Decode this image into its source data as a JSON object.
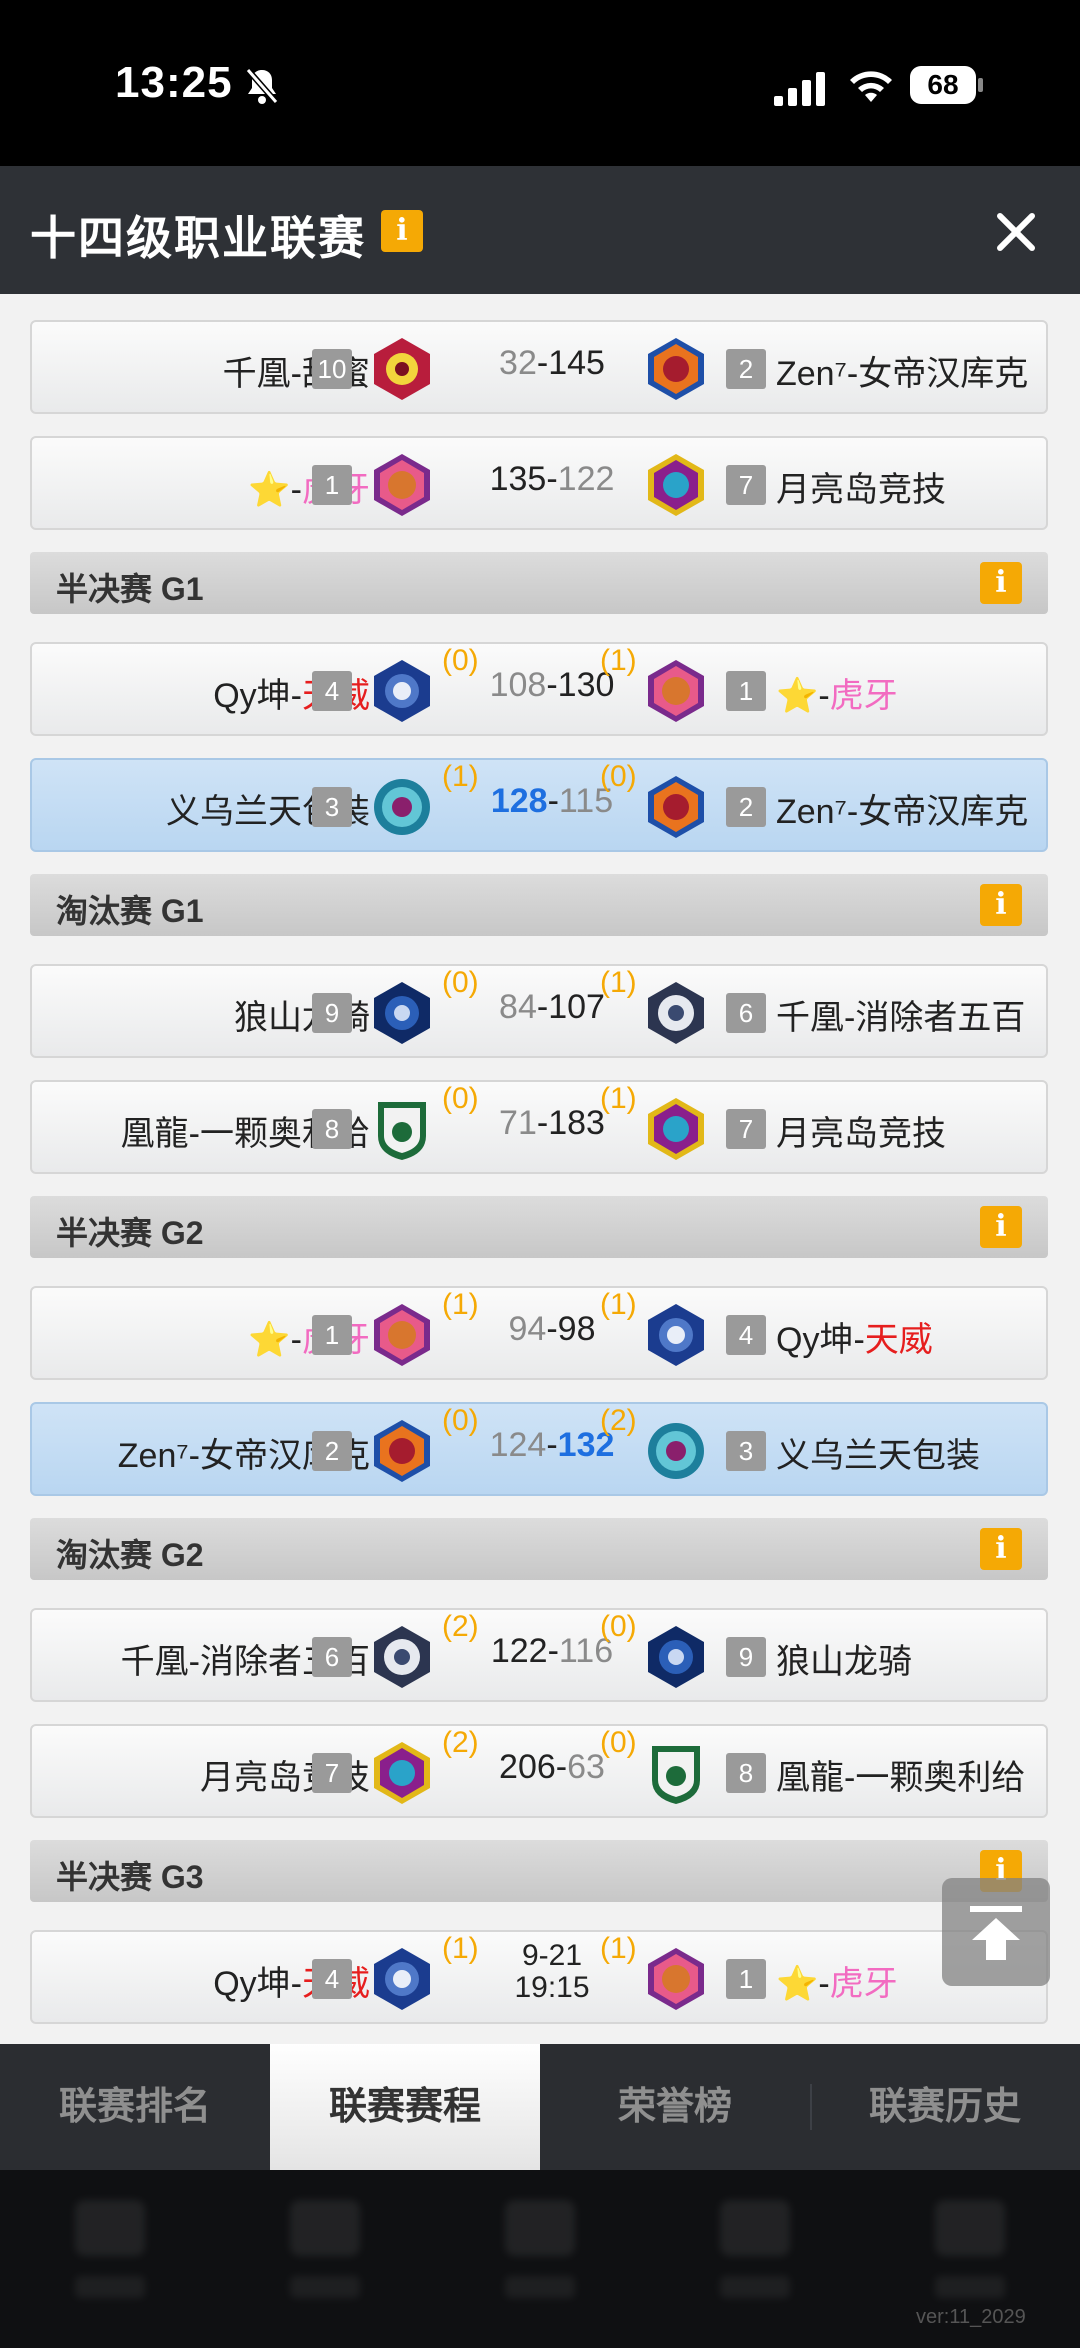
{
  "status_bar": {
    "time": "13:25",
    "battery": "68"
  },
  "header": {
    "title": "十四级职业联赛",
    "info_icon": "i"
  },
  "matches": [
    {
      "left": {
        "prefix": "千凰-",
        "name": "甜蜜",
        "seed": "10"
      },
      "score_left": "32",
      "sep": "-",
      "score_right": "145",
      "right": {
        "prefix": "Zen⁷-",
        "name": "女帝汉库克",
        "seed": "2"
      }
    },
    {
      "left": {
        "prefix": "⭐-",
        "name": "虎牙",
        "seed": "1"
      },
      "score_left": "135",
      "sep": "-",
      "score_right": "122",
      "right": {
        "prefix": "",
        "name": "月亮岛竞技",
        "seed": "7"
      }
    },
    {
      "left": {
        "prefix": "Qy坤-",
        "name": "天威",
        "seed": "4"
      },
      "wins_left": "(0)",
      "score_left": "108",
      "sep": "-",
      "score_right": "130",
      "wins_right": "(1)",
      "right": {
        "prefix": "⭐-",
        "name": "虎牙",
        "seed": "1"
      }
    },
    {
      "left": {
        "prefix": "",
        "name": "义乌兰天包装",
        "seed": "3"
      },
      "wins_left": "(1)",
      "score_left": "128",
      "sep": "-",
      "score_right": "115",
      "wins_right": "(0)",
      "right": {
        "prefix": "Zen⁷-",
        "name": "女帝汉库克",
        "seed": "2"
      }
    },
    {
      "left": {
        "prefix": "",
        "name": "狼山龙骑",
        "seed": "9"
      },
      "wins_left": "(0)",
      "score_left": "84",
      "sep": "-",
      "score_right": "107",
      "wins_right": "(1)",
      "right": {
        "prefix": "千凰-",
        "name": "消除者五百",
        "seed": "6"
      }
    },
    {
      "left": {
        "prefix": "凰龍-",
        "name": "一颗奥利给",
        "seed": "8"
      },
      "wins_left": "(0)",
      "score_left": "71",
      "sep": "-",
      "score_right": "183",
      "wins_right": "(1)",
      "right": {
        "prefix": "",
        "name": "月亮岛竞技",
        "seed": "7"
      }
    },
    {
      "left": {
        "prefix": "⭐-",
        "name": "虎牙",
        "seed": "1"
      },
      "wins_left": "(1)",
      "score_left": "94",
      "sep": "-",
      "score_right": "98",
      "wins_right": "(1)",
      "right": {
        "prefix": "Qy坤-",
        "name": "天威",
        "seed": "4"
      }
    },
    {
      "left": {
        "prefix": "Zen⁷-",
        "name": "女帝汉库克",
        "seed": "2"
      },
      "wins_left": "(0)",
      "score_left": "124",
      "sep": "-",
      "score_right": "132",
      "wins_right": "(2)",
      "right": {
        "prefix": "",
        "name": "义乌兰天包装",
        "seed": "3"
      }
    },
    {
      "left": {
        "prefix": "千凰-",
        "name": "消除者五百",
        "seed": "6"
      },
      "wins_left": "(2)",
      "score_left": "122",
      "sep": "-",
      "score_right": "116",
      "wins_right": "(0)",
      "right": {
        "prefix": "",
        "name": "狼山龙骑",
        "seed": "9"
      }
    },
    {
      "left": {
        "prefix": "",
        "name": "月亮岛竞技",
        "seed": "7"
      },
      "wins_left": "(2)",
      "score_left": "206",
      "sep": "-",
      "score_right": "63",
      "wins_right": "(0)",
      "right": {
        "prefix": "凰龍-",
        "name": "一颗奥利给",
        "seed": "8"
      }
    },
    {
      "left": {
        "prefix": "Qy坤-",
        "name": "天威",
        "seed": "4"
      },
      "wins_left": "(1)",
      "date": "9-21",
      "time": "19:15",
      "wins_right": "(1)",
      "right": {
        "prefix": "⭐-",
        "name": "虎牙",
        "seed": "1"
      }
    }
  ],
  "sections": [
    "半决赛 G1",
    "淘汰赛 G1",
    "半决赛 G2",
    "淘汰赛 G2",
    "半决赛 G3"
  ],
  "tabs": [
    "联赛排名",
    "联赛赛程",
    "荣誉榜",
    "联赛历史"
  ],
  "active_tab": "联赛赛程",
  "version": "ver:11_2029",
  "colors": {
    "accent": "#f5a905",
    "winner_blue": "#1e6fe0",
    "highlight_row": "#c3dcf3",
    "team_red": "#e61e1e",
    "team_pink": "#f26bc1"
  }
}
